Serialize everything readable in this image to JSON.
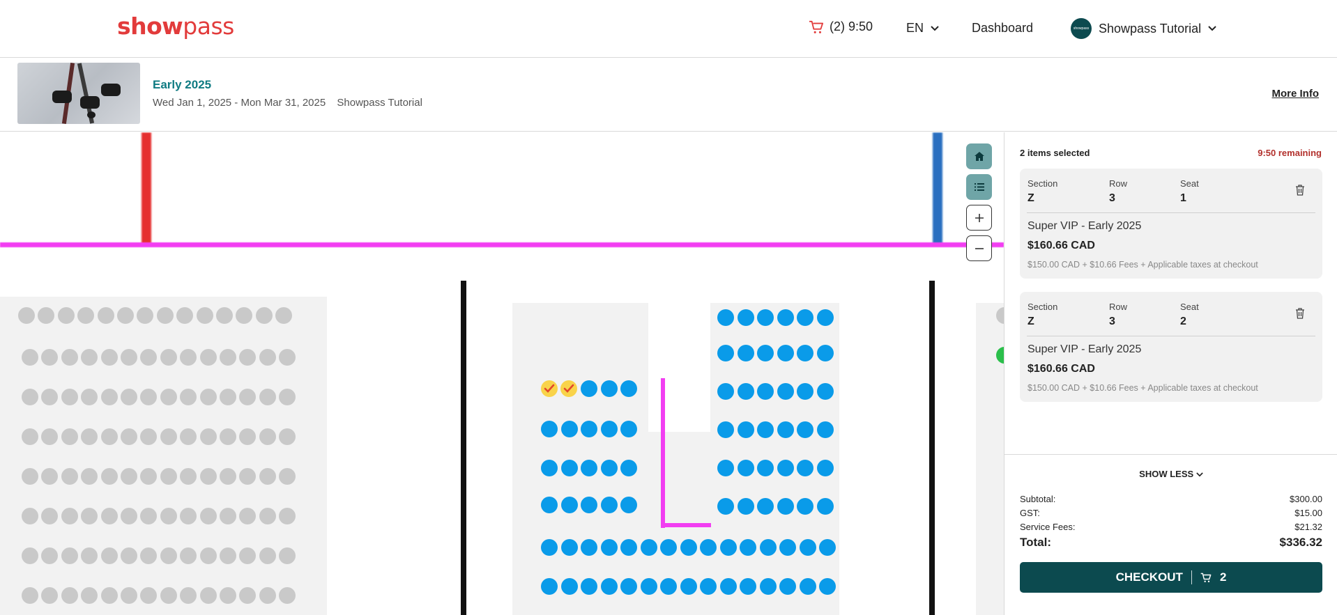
{
  "header": {
    "logo_bold": "show",
    "logo_thin": "pass",
    "cart_label": "(2) 9:50",
    "language": "EN",
    "dashboard": "Dashboard",
    "account_name": "Showpass Tutorial",
    "avatar_text": "showpass"
  },
  "event": {
    "title": "Early 2025",
    "dates": "Wed Jan 1, 2025 - Mon Mar 31, 2025",
    "organizer": "Showpass Tutorial",
    "more_info": "More Info"
  },
  "panel": {
    "selected_count": "2 items selected",
    "remaining": "9:50 remaining",
    "items": [
      {
        "section_label": "Section",
        "section": "Z",
        "row_label": "Row",
        "row": "3",
        "seat_label": "Seat",
        "seat": "1",
        "ticket_name": "Super VIP - Early 2025",
        "price": "$160.66 CAD",
        "fees": "$150.00 CAD + $10.66 Fees + Applicable taxes at checkout"
      },
      {
        "section_label": "Section",
        "section": "Z",
        "row_label": "Row",
        "row": "3",
        "seat_label": "Seat",
        "seat": "2",
        "ticket_name": "Super VIP - Early 2025",
        "price": "$160.66 CAD",
        "fees": "$150.00 CAD + $10.66 Fees + Applicable taxes at checkout"
      }
    ],
    "show_less": "SHOW LESS",
    "subtotal_label": "Subtotal:",
    "subtotal": "$300.00",
    "gst_label": "GST:",
    "gst": "$15.00",
    "service_label": "Service Fees:",
    "service": "$21.32",
    "total_label": "Total:",
    "total": "$336.32",
    "checkout_label": "CHECKOUT",
    "checkout_count": "2"
  },
  "colors": {
    "brand_red": "#e23b3b",
    "teal_dark": "#0c4a4f",
    "teal_link": "#0f7b82",
    "seat_available": "#0a9be9",
    "seat_unavailable": "#c9c9c9",
    "seat_selected": "#f9d34a",
    "remaining_red": "#b2302c"
  },
  "icons": {
    "cart": "cart-icon",
    "chevron": "chevron-down-icon",
    "home": "home-icon",
    "list": "list-icon",
    "zoom_in": "plus-icon",
    "zoom_out": "minus-icon",
    "trash": "trash-icon",
    "check": "check-icon"
  }
}
